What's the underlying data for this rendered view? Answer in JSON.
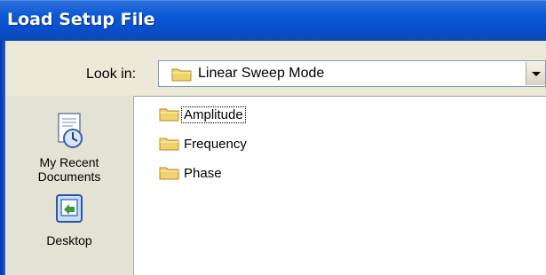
{
  "window": {
    "title": "Load Setup File"
  },
  "look_in": {
    "label": "Look in:",
    "value": "Linear Sweep Mode"
  },
  "places": [
    {
      "label_line1": "My Recent",
      "label_line2": "Documents",
      "icon": "recent-documents-icon"
    },
    {
      "label_line1": "Desktop",
      "label_line2": "",
      "icon": "desktop-icon"
    }
  ],
  "files": [
    {
      "name": "Amplitude",
      "icon": "folder-icon"
    },
    {
      "name": "Frequency",
      "icon": "folder-icon"
    },
    {
      "name": "Phase",
      "icon": "folder-icon"
    }
  ],
  "colors": {
    "titlebar": "#0a4fcc",
    "folder": "#f3d26b"
  }
}
